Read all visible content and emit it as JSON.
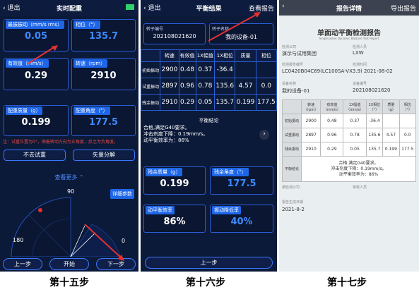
{
  "screen1": {
    "back": "退出",
    "title": "实时配重",
    "max_vib_label": "最振振动（mm/s rms）",
    "max_vib_value": "0.05",
    "phase_label": "相位（°）",
    "phase_value": "135.7",
    "eff_label": "有效值（mm/s）",
    "eff_value": "0.29",
    "speed_label": "转速（rpm）",
    "speed_value": "2910",
    "wmass_label": "配重质量（g）",
    "wmass_value": "0.199",
    "wangle_label": "配重角度（°）",
    "wangle_value": "177.5",
    "note": "注：试重位置为0°，顺着转动方向为正角度，反之为负角度。",
    "btn_no_trial": "不去试重",
    "btn_vector": "矢量分解",
    "see_more": "查看更多",
    "detail_params": "详细参数",
    "polar_90": "90",
    "polar_180": "180",
    "polar_0": "0",
    "btn_prev": "上一步",
    "btn_start": "开始",
    "btn_next": "下一步"
  },
  "screen2": {
    "back": "退出",
    "title": "平衡结果",
    "view_report": "查看报告",
    "rotor_no_label": "转子编号",
    "rotor_no_value": "202108021620",
    "rotor_name_label": "转子名称",
    "rotor_name_value": "我的设备-01",
    "table_headers": [
      "",
      "转速",
      "有效值",
      "1X幅值",
      "1X相位",
      "质量",
      "相位"
    ],
    "table_rows": [
      [
        "初始振动",
        "2900",
        "0.48",
        "0.37",
        "-36.4",
        "",
        ""
      ],
      [
        "试重振动",
        "2897",
        "0.96",
        "0.78",
        "135.6",
        "4.57",
        "0.0"
      ],
      [
        "残余振动",
        "2910",
        "0.29",
        "0.05",
        "135.7",
        "0.199",
        "177.5"
      ]
    ],
    "conclusion_title": "平衡结论",
    "conclusion_lines": [
      "合格,满足G40要求。",
      "冲击剂度下降：0.19mm/s。",
      "动平衡效率为：86%"
    ],
    "res_mass_label": "残余质量（g）",
    "res_mass_value": "0.199",
    "res_angle_label": "残余角度（°）",
    "res_angle_value": "177.5",
    "eff_label": "动平衡效率",
    "eff_value": "86%",
    "drop_label": "振动降低率",
    "drop_value": "40%",
    "btn_prev": "上一步"
  },
  "screen3": {
    "back": "",
    "title": "报告详情",
    "export": "导出报告",
    "report_title": "单面动平衡检测报告",
    "report_subtitle": "Single-plane Dynamic Balance Test Report",
    "org_label": "检测公司",
    "org_value": "演示与试用集团",
    "person_label": "检测人员",
    "person_value": "LXW",
    "id_label": "检测报告编号",
    "time_label": "检测时间",
    "id_value": "LC0420B04C69(LC100SA-VX3.9) 2021-08-02",
    "device_label": "设备名称",
    "device_no_label": "设备编号",
    "device_value": "我的设备-01",
    "device_no_value": "202108021620",
    "table_headers": [
      "",
      "转速\n（rpm）",
      "有效值\n（mm/s）",
      "1X幅值\n（mm/s）",
      "1X相位\n（°）",
      "质量\n（g）",
      "相位\n（°）"
    ],
    "table_rows": [
      [
        "初始振动",
        "2900",
        "0.48",
        "0.37",
        "-36.4",
        "",
        ""
      ],
      [
        "试重振动",
        "2897",
        "0.96",
        "0.78",
        "135.6",
        "4.57",
        "0.0"
      ],
      [
        "残余振动",
        "2910",
        "0.29",
        "0.05",
        "135.7",
        "0.199",
        "177.5"
      ]
    ],
    "conclusion_label": "平衡结论",
    "conclusion_lines": [
      "合格,满足G40要求。",
      "冲击剂度下降：0.19mm/s。",
      "动平衡效率为：86%"
    ],
    "maint_label": "被检测公司",
    "appr_label": "审核人员",
    "date_label": "报告生成日期",
    "date_value": "2021-8-2"
  },
  "captions": [
    "第十五步",
    "第十六步",
    "第十七步"
  ],
  "colors": {
    "dark_bg": "#0c1a3a",
    "accent_blue": "#1e66e8",
    "value_blue": "#3d8bff",
    "arrow_red": "#e33131"
  }
}
